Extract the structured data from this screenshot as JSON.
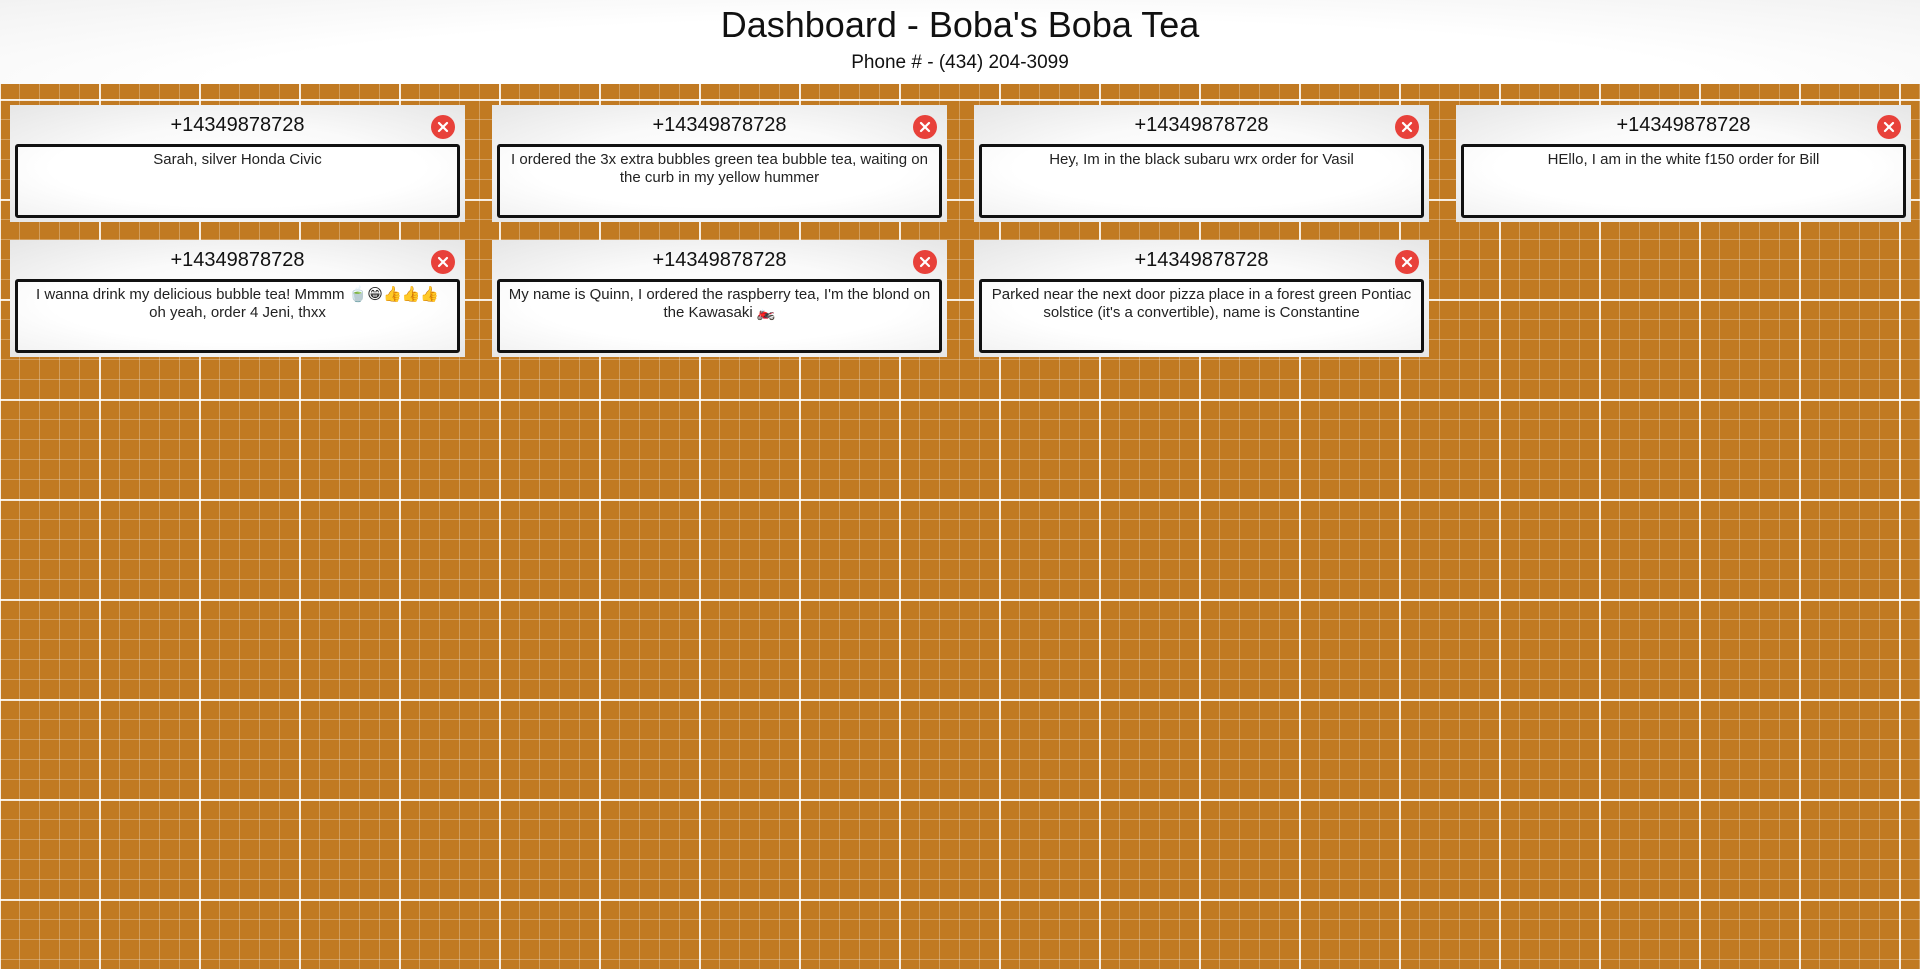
{
  "header": {
    "title": "Dashboard - Boba's Boba Tea",
    "phone": "Phone # - (434) 204-3099"
  },
  "colors": {
    "background": "#c17a22",
    "close_button": "#e8413a"
  },
  "close_icon": "close-icon",
  "orders": [
    {
      "phone": "+14349878728",
      "message": "Sarah, silver Honda Civic"
    },
    {
      "phone": "+14349878728",
      "message": "I ordered the 3x extra bubbles green tea bubble tea, waiting on the curb in my yellow hummer"
    },
    {
      "phone": "+14349878728",
      "message": "Hey, Im in the black subaru wrx order for Vasil"
    },
    {
      "phone": "+14349878728",
      "message": "HEllo, I am in the white f150 order for Bill"
    },
    {
      "phone": "+14349878728",
      "message": "I wanna drink my delicious bubble tea! Mmmm 🍵😁👍👍👍 oh yeah, order 4 Jeni, thxx"
    },
    {
      "phone": "+14349878728",
      "message": "My name is Quinn, I ordered the raspberry tea, I'm the blond on the Kawasaki 🏍️"
    },
    {
      "phone": "+14349878728",
      "message": "Parked near the next door pizza place in a forest green Pontiac solstice (it's a convertible), name is Constantine"
    }
  ]
}
